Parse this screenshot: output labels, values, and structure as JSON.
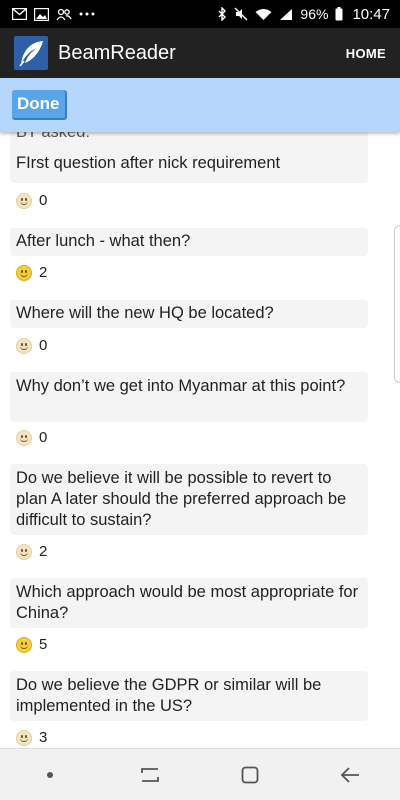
{
  "status_bar": {
    "battery": "96%",
    "time": "10:47",
    "left_icons": [
      "mail-icon",
      "image-icon",
      "people-icon",
      "more-icon"
    ],
    "right_icons": [
      "bluetooth-icon",
      "mute-icon",
      "wifi-icon",
      "signal-icon",
      "battery-icon"
    ]
  },
  "app_bar": {
    "title": "BeamReader",
    "home_label": "HOME",
    "logo_icon": "feather-icon"
  },
  "edit_bar": {
    "done_label": "Done"
  },
  "colors": {
    "app_bar": "#222222",
    "edit_bar": "#b4d7fb",
    "done_button": "#5aa4ea",
    "card": "#f4f4f4"
  },
  "questions": [
    {
      "partial_text": "BT asked:",
      "text": "FIrst question after nick requirement",
      "votes": "0",
      "voted": false
    },
    {
      "text": "After lunch - what then?",
      "votes": "2",
      "voted": true
    },
    {
      "text": "Where will the new HQ be located?",
      "votes": "0",
      "voted": false
    },
    {
      "text": "Why don’t we get into Myanmar at this point?",
      "votes": "0",
      "voted": false
    },
    {
      "text": "Do we believe it will be possible to revert to plan A later should the preferred approach be difficult to sustain?",
      "votes": "2",
      "voted": false
    },
    {
      "text": "Which approach would be most appropriate for China?",
      "votes": "5",
      "voted": true
    },
    {
      "text": "Do we believe the GDPR or similar will be implemented in the US?",
      "votes": "3",
      "voted": false
    }
  ],
  "nav_bar": {
    "items": [
      "dot-icon",
      "recent-apps-icon",
      "home-icon",
      "back-icon"
    ]
  }
}
